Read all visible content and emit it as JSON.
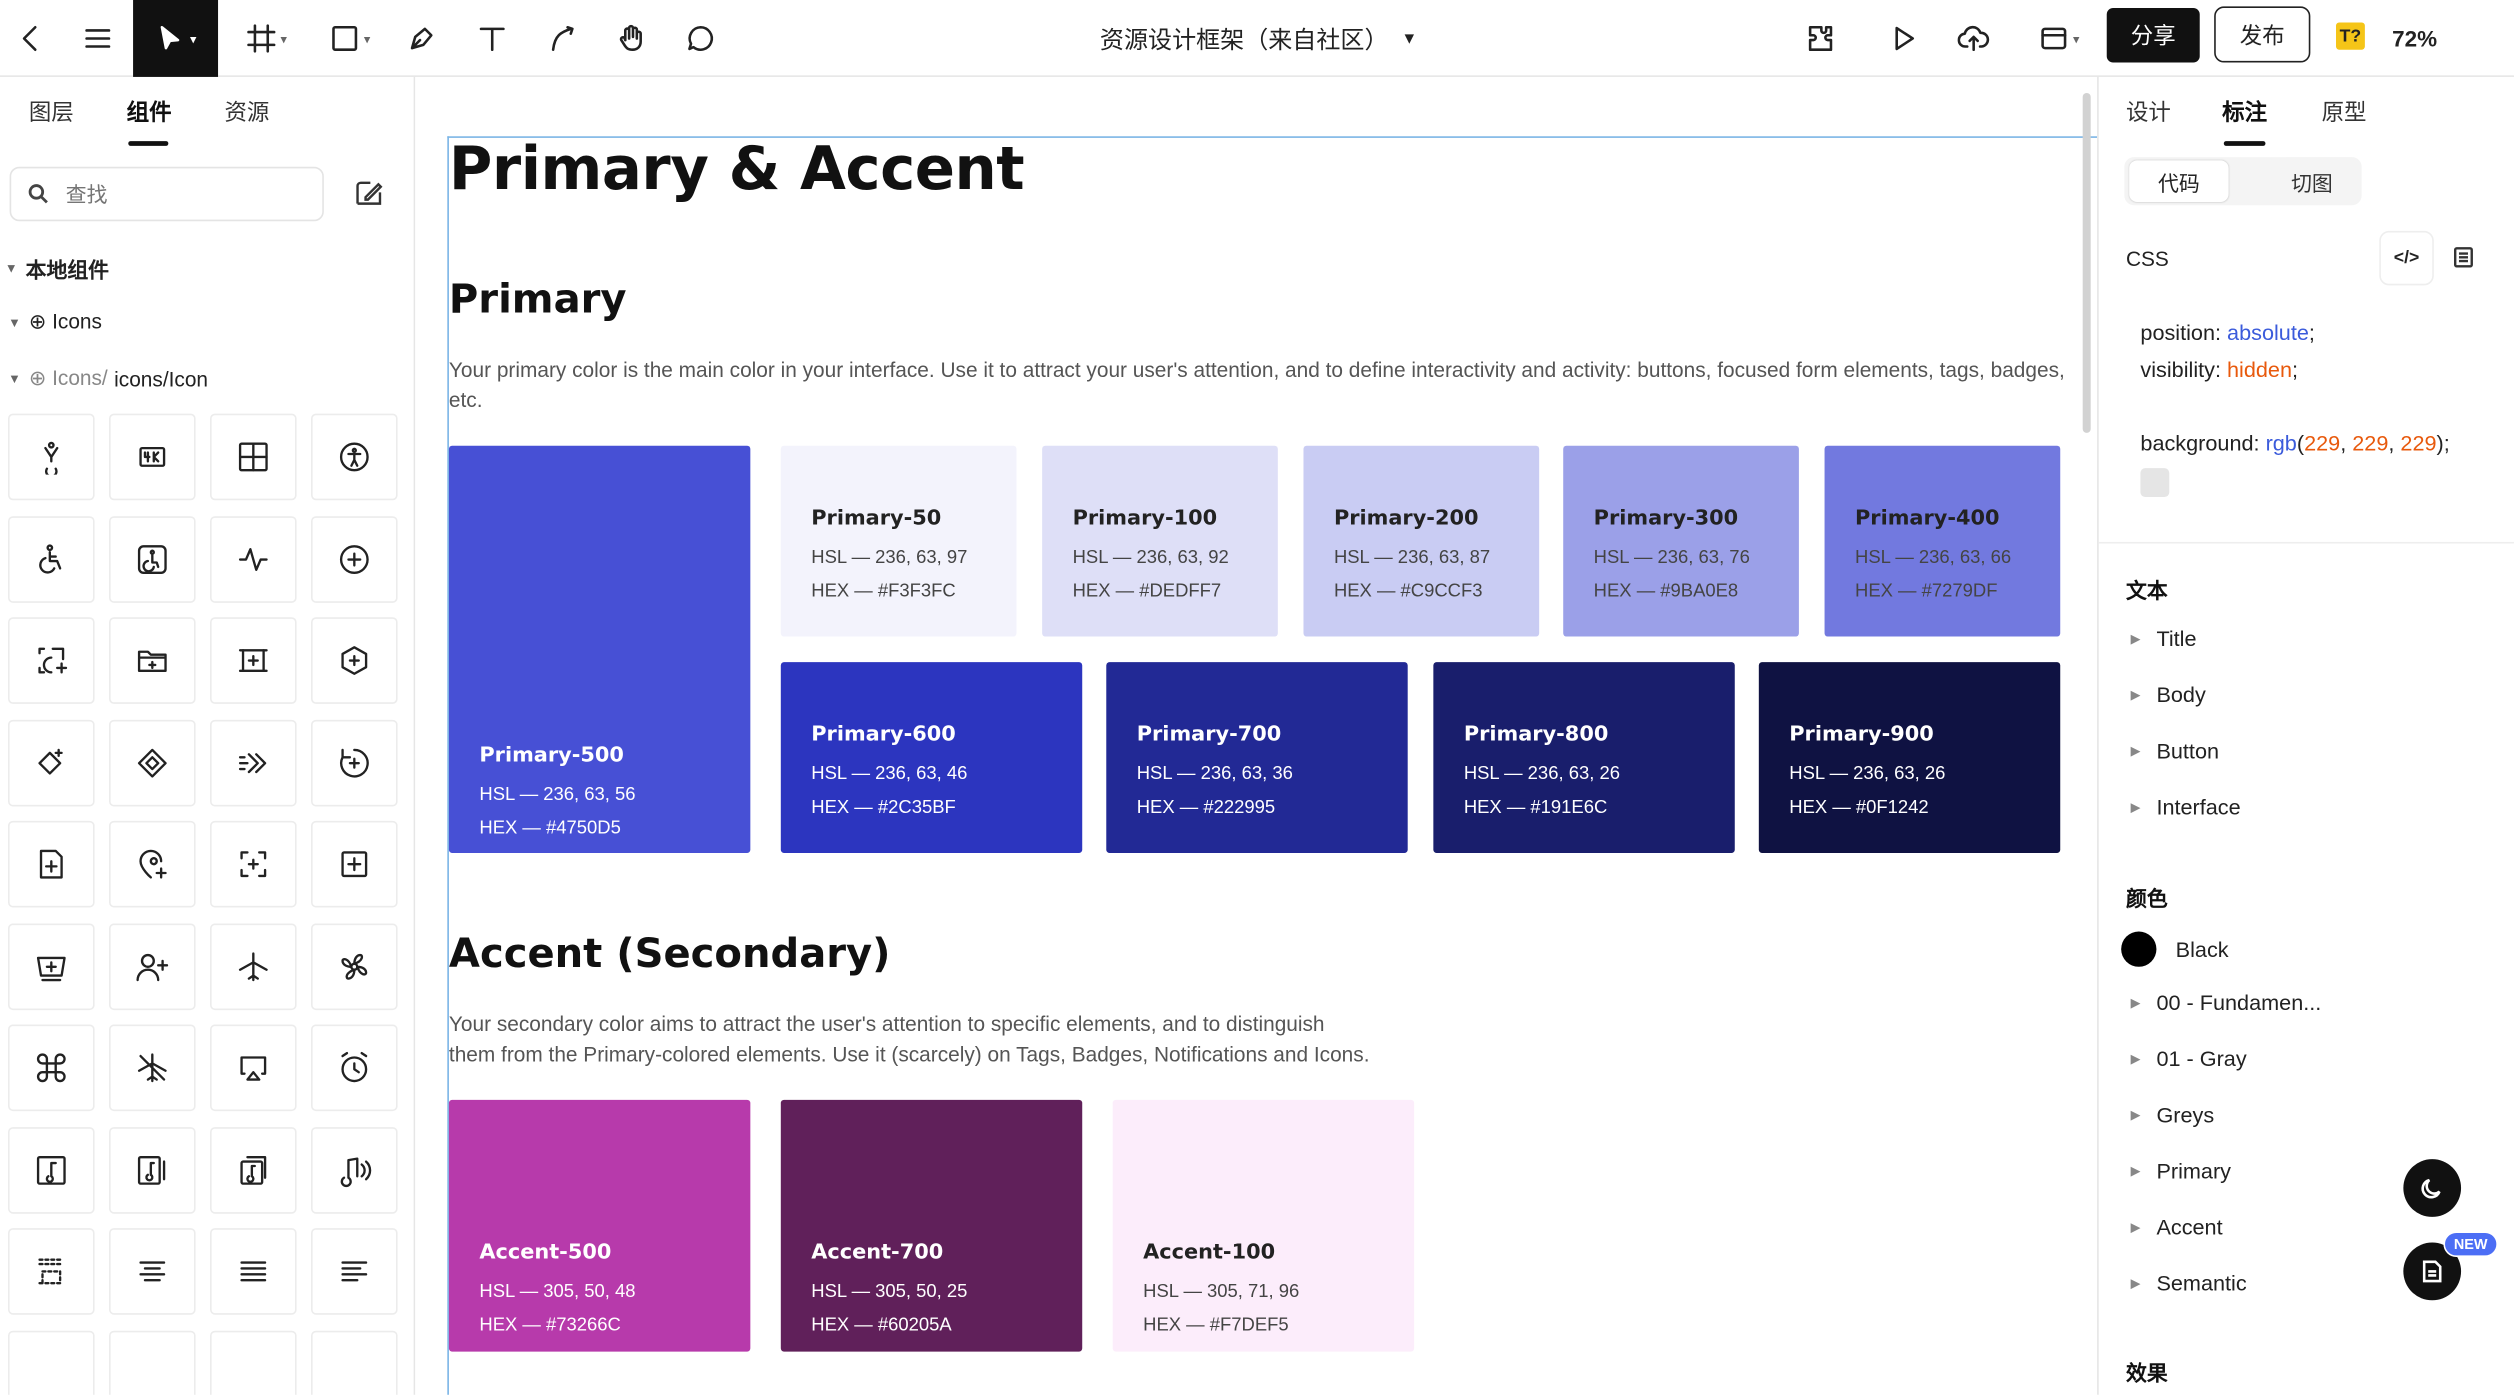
{
  "toolbar": {
    "doc_title": "资源设计框架（来自社区）",
    "share_label": "分享",
    "publish_label": "发布",
    "font_badge": "T?",
    "zoom": "72%",
    "icons": [
      "back-icon",
      "menu-icon",
      "pointer-icon",
      "frame-icon",
      "rectangle-icon",
      "pen-icon",
      "text-icon",
      "path-icon",
      "hand-icon",
      "comment-icon",
      "plugin-icon",
      "play-icon",
      "upload-icon",
      "layout-icon"
    ]
  },
  "left": {
    "tabs": [
      "图层",
      "组件",
      "资源"
    ],
    "active_tab": "组件",
    "search_placeholder": "查找",
    "local_components": "本地组件",
    "tree_icons": "⊕ Icons",
    "tree_path_prefix": "⊕ Icons/",
    "tree_path_rest": "icons/Icon",
    "grid_icons": [
      "accessibility-icon",
      "4k-icon",
      "grid-icon",
      "accessibility-circle-icon",
      "wheelchair-icon",
      "wheelchair-square-icon",
      "activity-icon",
      "add-circle-icon",
      "add-scan-icon",
      "add-folder-icon",
      "add-frame-icon",
      "add-hexagon-icon",
      "add-diamond-icon",
      "diamond-icon",
      "advance-icon",
      "refresh-add-icon",
      "add-file-icon",
      "add-location-icon",
      "add-focus-icon",
      "add-square-icon",
      "add-basket-icon",
      "add-user-icon",
      "airplane-icon",
      "fan-icon",
      "command-icon",
      "airplane-off-icon",
      "airplay-icon",
      "alarm-icon",
      "music-note-icon",
      "music-bar-icon",
      "music-file-icon",
      "music-wave-icon",
      "align-bottom-icon",
      "align-center-icon",
      "align-justify-icon",
      "align-left-icon"
    ]
  },
  "canvas": {
    "page_title": "Primary & Accent",
    "primary": {
      "title": "Primary",
      "description": "Your primary color is the main color in your interface. Use it to attract your user's attention, and to define interactivity and activity: buttons, focused form elements, tags, badges, etc.",
      "swatches": [
        {
          "name": "Primary-500",
          "hsl": "HSL — 236, 63, 56",
          "hex": "HEX — #4750D5",
          "color": "#4750D5",
          "dark": true
        },
        {
          "name": "Primary-50",
          "hsl": "HSL — 236, 63, 97",
          "hex": "HEX — #F3F3FC",
          "color": "#F3F3FC",
          "dark": false
        },
        {
          "name": "Primary-100",
          "hsl": "HSL — 236, 63, 92",
          "hex": "HEX — #DEDFF7",
          "color": "#DEDFF7",
          "dark": false
        },
        {
          "name": "Primary-200",
          "hsl": "HSL — 236, 63, 87",
          "hex": "HEX — #C9CCF3",
          "color": "#C9CCF3",
          "dark": false
        },
        {
          "name": "Primary-300",
          "hsl": "HSL — 236, 63, 76",
          "hex": "HEX — #9BA0E8",
          "color": "#9BA0E8",
          "dark": false
        },
        {
          "name": "Primary-400",
          "hsl": "HSL — 236, 63, 66",
          "hex": "HEX — #7279DF",
          "color": "#7279DF",
          "dark": false
        },
        {
          "name": "Primary-600",
          "hsl": "HSL — 236, 63, 46",
          "hex": "HEX — #2C35BF",
          "color": "#2C35BF",
          "dark": true
        },
        {
          "name": "Primary-700",
          "hsl": "HSL — 236, 63, 36",
          "hex": "HEX — #222995",
          "color": "#222995",
          "dark": true
        },
        {
          "name": "Primary-800",
          "hsl": "HSL — 236, 63, 26",
          "hex": "HEX — #191E6C",
          "color": "#191E6C",
          "dark": true
        },
        {
          "name": "Primary-900",
          "hsl": "HSL — 236, 63, 26",
          "hex": "HEX — #0F1242",
          "color": "#0F1242",
          "dark": true
        }
      ]
    },
    "accent": {
      "title": "Accent (Secondary)",
      "description_line1": "Your secondary color aims to attract the user's attention to specific elements, and to distinguish",
      "description_line2": "them from the Primary-colored elements. Use it (scarcely) on Tags, Badges, Notifications and Icons.",
      "swatches": [
        {
          "name": "Accent-500",
          "hsl": "HSL — 305, 50, 48",
          "hex": "HEX — #73266C",
          "color": "#B73AAB",
          "dark": true
        },
        {
          "name": "Accent-700",
          "hsl": "HSL — 305, 50, 25",
          "hex": "HEX — #60205A",
          "color": "#60205A",
          "dark": true
        },
        {
          "name": "Accent-100",
          "hsl": "HSL — 305, 71, 96",
          "hex": "HEX — #F7DEF5",
          "color": "#FCEDFB",
          "dark": false
        }
      ]
    }
  },
  "right": {
    "tabs": [
      "设计",
      "标注",
      "原型"
    ],
    "active_tab": "标注",
    "seg_code": "代码",
    "seg_slice": "切图",
    "css_label": "CSS",
    "code_view_glyph": "</>",
    "code": {
      "position_prop": "position: ",
      "position_val": "absolute",
      "visibility_prop": "visibility: ",
      "visibility_val": "hidden",
      "background_prop": "background: ",
      "background_fn": "rgb",
      "r": "229",
      "g": "229",
      "b": "229"
    },
    "text_section": "文本",
    "text_styles": [
      "Title",
      "Body",
      "Button",
      "Interface"
    ],
    "color_section": "颜色",
    "color_black": "Black",
    "color_groups": [
      "00 - Fundamen...",
      "01 - Gray",
      "Greys",
      "Primary",
      "Accent",
      "Semantic"
    ],
    "effects_section": "效果",
    "new_badge": "NEW"
  }
}
